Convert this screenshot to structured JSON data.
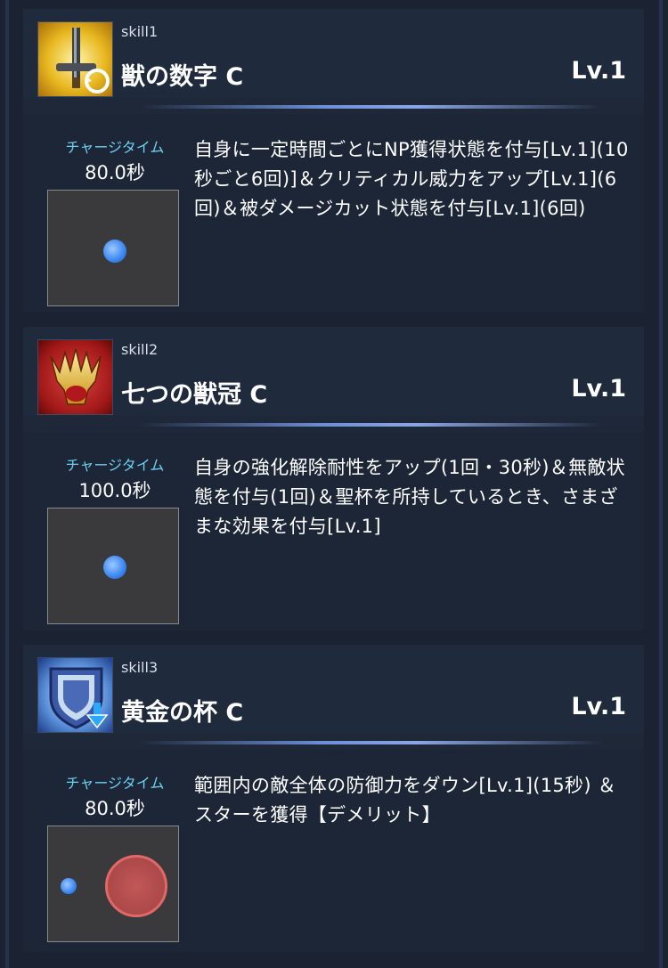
{
  "skills": [
    {
      "num": "skill1",
      "name": "獣の数字 C",
      "level": "Lv.1",
      "charge_label": "チャージタイム",
      "charge_value": "80.0秒",
      "description": "自身に一定時間ごとにNP獲得状態を付与[Lv.1](10秒ごと6回)]＆クリティカル威力をアップ[Lv.1](6回)＆被ダメージカット状態を付与[Lv.1](6回)",
      "icon": "sword-icon"
    },
    {
      "num": "skill2",
      "name": "七つの獣冠 C",
      "level": "Lv.1",
      "charge_label": "チャージタイム",
      "charge_value": "100.0秒",
      "description": "自身の強化解除耐性をアップ(1回・30秒)＆無敵状態を付与(1回)＆聖杯を所持しているとき、さまざまな効果を付与[Lv.1]",
      "icon": "crown-icon"
    },
    {
      "num": "skill3",
      "name": "黄金の杯 C",
      "level": "Lv.1",
      "charge_label": "チャージタイム",
      "charge_value": "80.0秒",
      "description": "範囲内の敵全体の防御力をダウン[Lv.1](15秒) ＆スターを獲得【デメリット】",
      "icon": "shield-down-icon"
    }
  ],
  "colors": {
    "background": "#1b2333",
    "charge_label": "#6ed0f0",
    "divider": "#6d8fd8"
  }
}
